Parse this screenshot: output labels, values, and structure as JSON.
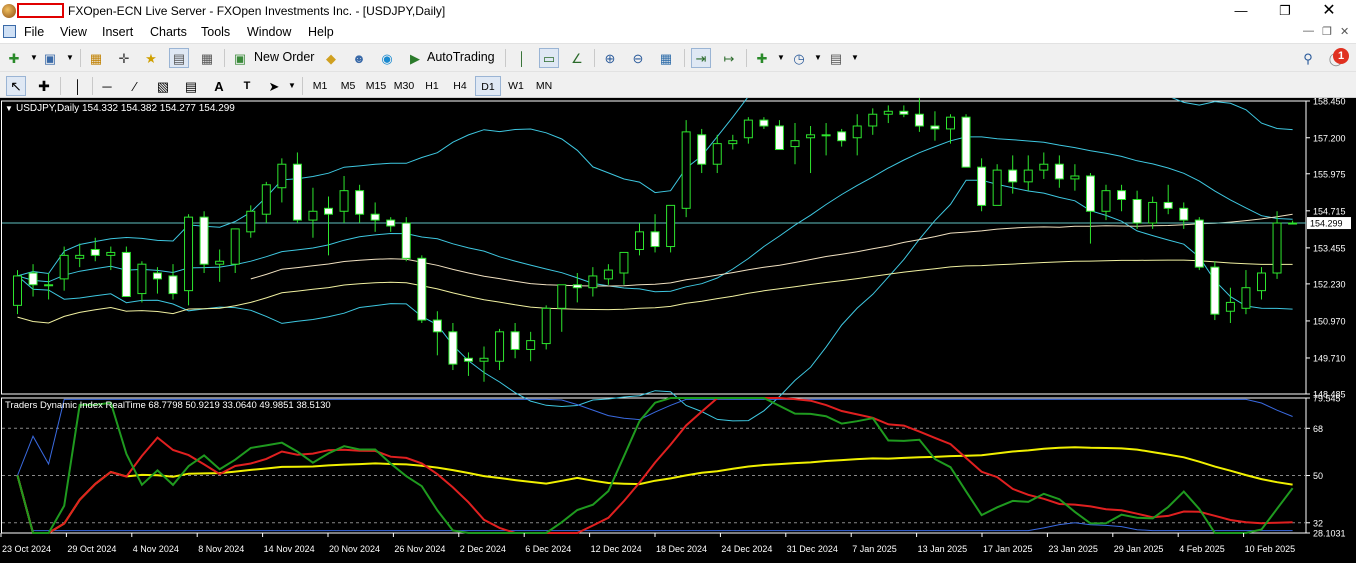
{
  "window": {
    "title": "FXOpen-ECN Live Server - FXOpen Investments Inc. - [USDJPY,Daily]",
    "minimize_icon": "minimize-icon",
    "maximize_icon": "restore-icon",
    "close_icon": "close-icon"
  },
  "menu": [
    "File",
    "View",
    "Insert",
    "Charts",
    "Tools",
    "Window",
    "Help"
  ],
  "toolbar": {
    "new_order": "New Order",
    "autotrading": "AutoTrading"
  },
  "notifications": {
    "count": "1"
  },
  "timeframes": [
    "M1",
    "M5",
    "M15",
    "M30",
    "H1",
    "H4",
    "D1",
    "W1",
    "MN"
  ],
  "active_timeframe": "D1",
  "chart_header": {
    "label": "USDJPY,Daily",
    "ohlc": "154.332 154.382 154.277 154.299"
  },
  "indicator_header": "Traders Dynamic Index RealTime 68.7798 50.9219 33.0640 49.9851 38.5130",
  "chart_data": [
    {
      "type": "candlestick",
      "symbol": "USDJPY",
      "timeframe": "Daily",
      "current_price": "154.299",
      "ylim": [
        148.485,
        158.45
      ],
      "y_ticks": [
        "158.450",
        "157.200",
        "155.975",
        "154.715",
        "153.455",
        "152.230",
        "150.970",
        "149.710",
        "148.485"
      ],
      "x_ticks": [
        "23 Oct 2024",
        "29 Oct 2024",
        "4 Nov 2024",
        "8 Nov 2024",
        "14 Nov 2024",
        "20 Nov 2024",
        "26 Nov 2024",
        "2 Dec 2024",
        "6 Dec 2024",
        "12 Dec 2024",
        "18 Dec 2024",
        "24 Dec 2024",
        "31 Dec 2024",
        "7 Jan 2025",
        "13 Jan 2025",
        "17 Jan 2025",
        "23 Jan 2025",
        "29 Jan 2025",
        "4 Feb 2025",
        "10 Feb 2025"
      ],
      "candles_ohlc": [
        [
          151.5,
          152.7,
          151.2,
          152.5
        ],
        [
          152.6,
          152.9,
          151.8,
          152.2
        ],
        [
          152.2,
          152.6,
          151.7,
          152.2
        ],
        [
          152.4,
          153.5,
          152.0,
          153.2
        ],
        [
          153.1,
          153.6,
          152.8,
          153.2
        ],
        [
          153.4,
          153.8,
          153.0,
          153.2
        ],
        [
          153.2,
          153.5,
          152.7,
          153.3
        ],
        [
          153.3,
          153.5,
          151.8,
          151.8
        ],
        [
          151.9,
          153.0,
          151.6,
          152.9
        ],
        [
          152.6,
          152.8,
          151.9,
          152.4
        ],
        [
          152.5,
          152.9,
          151.7,
          151.9
        ],
        [
          152.0,
          154.6,
          151.5,
          154.5
        ],
        [
          154.5,
          154.7,
          152.6,
          152.9
        ],
        [
          152.9,
          153.4,
          152.3,
          153.0
        ],
        [
          152.9,
          154.1,
          152.6,
          154.1
        ],
        [
          154.0,
          154.9,
          153.8,
          154.7
        ],
        [
          154.6,
          155.7,
          154.3,
          155.6
        ],
        [
          155.5,
          156.5,
          155.0,
          156.3
        ],
        [
          156.3,
          156.7,
          154.3,
          154.4
        ],
        [
          154.4,
          155.5,
          153.8,
          154.7
        ],
        [
          154.8,
          155.2,
          153.2,
          154.6
        ],
        [
          154.7,
          155.9,
          154.3,
          155.4
        ],
        [
          155.4,
          155.6,
          154.3,
          154.6
        ],
        [
          154.6,
          155.0,
          154.0,
          154.4
        ],
        [
          154.4,
          154.5,
          154.0,
          154.2
        ],
        [
          154.3,
          154.5,
          153.0,
          153.1
        ],
        [
          153.1,
          153.2,
          150.9,
          151.0
        ],
        [
          151.0,
          151.3,
          149.8,
          150.6
        ],
        [
          150.6,
          150.9,
          149.3,
          149.5
        ],
        [
          149.7,
          149.9,
          149.1,
          149.6
        ],
        [
          149.6,
          150.1,
          148.9,
          149.7
        ],
        [
          149.6,
          150.7,
          149.3,
          150.6
        ],
        [
          150.6,
          150.9,
          149.7,
          150.0
        ],
        [
          150.0,
          150.6,
          149.6,
          150.3
        ],
        [
          150.2,
          151.5,
          150.0,
          151.4
        ],
        [
          151.4,
          152.2,
          150.6,
          152.2
        ],
        [
          152.2,
          152.6,
          151.6,
          152.1
        ],
        [
          152.1,
          152.8,
          151.8,
          152.5
        ],
        [
          152.4,
          152.9,
          152.2,
          152.7
        ],
        [
          152.6,
          153.3,
          152.2,
          153.3
        ],
        [
          153.4,
          154.3,
          153.2,
          154.0
        ],
        [
          154.0,
          154.6,
          153.3,
          153.5
        ],
        [
          153.5,
          154.9,
          153.3,
          154.9
        ],
        [
          154.8,
          157.8,
          154.5,
          157.4
        ],
        [
          157.3,
          157.5,
          156.0,
          156.3
        ],
        [
          156.3,
          157.3,
          156.0,
          157.0
        ],
        [
          157.0,
          157.3,
          156.8,
          157.1
        ],
        [
          157.2,
          157.9,
          157.0,
          157.8
        ],
        [
          157.8,
          157.9,
          157.5,
          157.6
        ],
        [
          157.6,
          157.8,
          156.8,
          156.8
        ],
        [
          156.9,
          157.7,
          156.3,
          157.1
        ],
        [
          157.2,
          157.6,
          156.0,
          157.3
        ],
        [
          157.3,
          157.7,
          156.6,
          157.3
        ],
        [
          157.4,
          157.5,
          156.9,
          157.1
        ],
        [
          157.2,
          158.0,
          156.6,
          157.6
        ],
        [
          157.6,
          158.2,
          157.3,
          158.0
        ],
        [
          158.0,
          158.3,
          157.7,
          158.1
        ],
        [
          158.1,
          158.3,
          157.9,
          158.0
        ],
        [
          158.0,
          158.7,
          157.4,
          157.6
        ],
        [
          157.6,
          158.1,
          157.1,
          157.5
        ],
        [
          157.5,
          158.0,
          157.0,
          157.9
        ],
        [
          157.9,
          158.0,
          156.3,
          156.2
        ],
        [
          156.2,
          156.5,
          154.7,
          154.9
        ],
        [
          154.9,
          156.3,
          154.9,
          156.1
        ],
        [
          156.1,
          156.6,
          155.3,
          155.7
        ],
        [
          155.7,
          156.6,
          155.4,
          156.1
        ],
        [
          156.1,
          156.7,
          155.8,
          156.3
        ],
        [
          156.3,
          156.6,
          155.5,
          155.8
        ],
        [
          155.8,
          156.3,
          155.4,
          155.9
        ],
        [
          155.9,
          156.0,
          153.6,
          154.7
        ],
        [
          154.7,
          155.6,
          154.4,
          155.4
        ],
        [
          155.4,
          155.6,
          154.7,
          155.1
        ],
        [
          155.1,
          155.4,
          154.1,
          154.3
        ],
        [
          154.3,
          155.2,
          154.1,
          155.0
        ],
        [
          155.0,
          155.6,
          154.6,
          154.8
        ],
        [
          154.8,
          155.0,
          154.1,
          154.4
        ],
        [
          154.4,
          154.5,
          152.7,
          152.8
        ],
        [
          152.8,
          153.0,
          151.0,
          151.2
        ],
        [
          151.3,
          152.1,
          150.9,
          151.6
        ],
        [
          151.4,
          152.7,
          151.2,
          152.1
        ],
        [
          152.0,
          152.8,
          151.7,
          152.6
        ],
        [
          152.6,
          154.7,
          152.4,
          154.3
        ],
        [
          154.3,
          154.38,
          154.28,
          154.3
        ]
      ]
    },
    {
      "type": "line",
      "name": "Traders Dynamic Index RealTime",
      "values_shown": [
        68.7798,
        50.9219,
        33.064,
        49.9851,
        38.513
      ],
      "ylim": [
        28.1031,
        79.545
      ],
      "y_ticks": [
        "79.545",
        "68",
        "50",
        "32",
        "28.1031"
      ]
    }
  ]
}
